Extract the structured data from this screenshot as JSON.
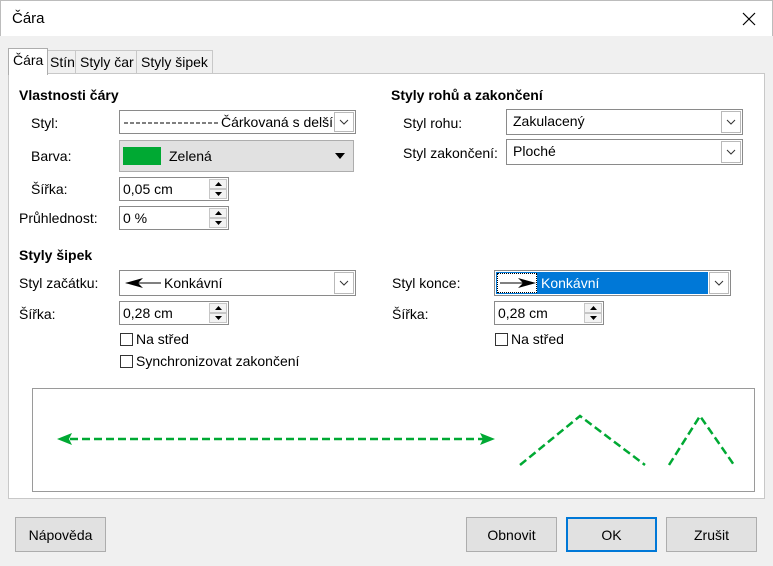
{
  "window": {
    "title": "Čára"
  },
  "tabs": [
    {
      "label": "Čára",
      "active": true
    },
    {
      "label": "Stín"
    },
    {
      "label": "Styly čar"
    },
    {
      "label": "Styly šipek"
    }
  ],
  "line_props": {
    "heading": "Vlastnosti čáry",
    "style_label": "Styl:",
    "style_value": "Čárkovaná s delší",
    "color_label": "Barva:",
    "color_value": "Zelená",
    "color_hex": "#00a933",
    "width_label": "Šířka:",
    "width_value": "0,05 cm",
    "transparency_label": "Průhlednost:",
    "transparency_value": "0 %"
  },
  "corner_caps": {
    "heading": "Styly rohů a zakončení",
    "corner_label": "Styl rohu:",
    "corner_value": "Zakulacený",
    "cap_label": "Styl zakončení:",
    "cap_value": "Ploché"
  },
  "arrows": {
    "heading": "Styly šipek",
    "start_label": "Styl začátku:",
    "start_value": "Konkávní",
    "start_width_label": "Šířka:",
    "start_width_value": "0,28 cm",
    "start_center_label": "Na střed",
    "sync_label": "Synchronizovat zakončení",
    "end_label": "Styl konce:",
    "end_value": "Konkávní",
    "end_width_label": "Šířka:",
    "end_width_value": "0,28 cm",
    "end_center_label": "Na střed"
  },
  "buttons": {
    "help": "Nápověda",
    "reset": "Obnovit",
    "ok": "OK",
    "cancel": "Zrušit"
  },
  "colors": {
    "accent": "#0078d7",
    "line": "#00a933"
  }
}
